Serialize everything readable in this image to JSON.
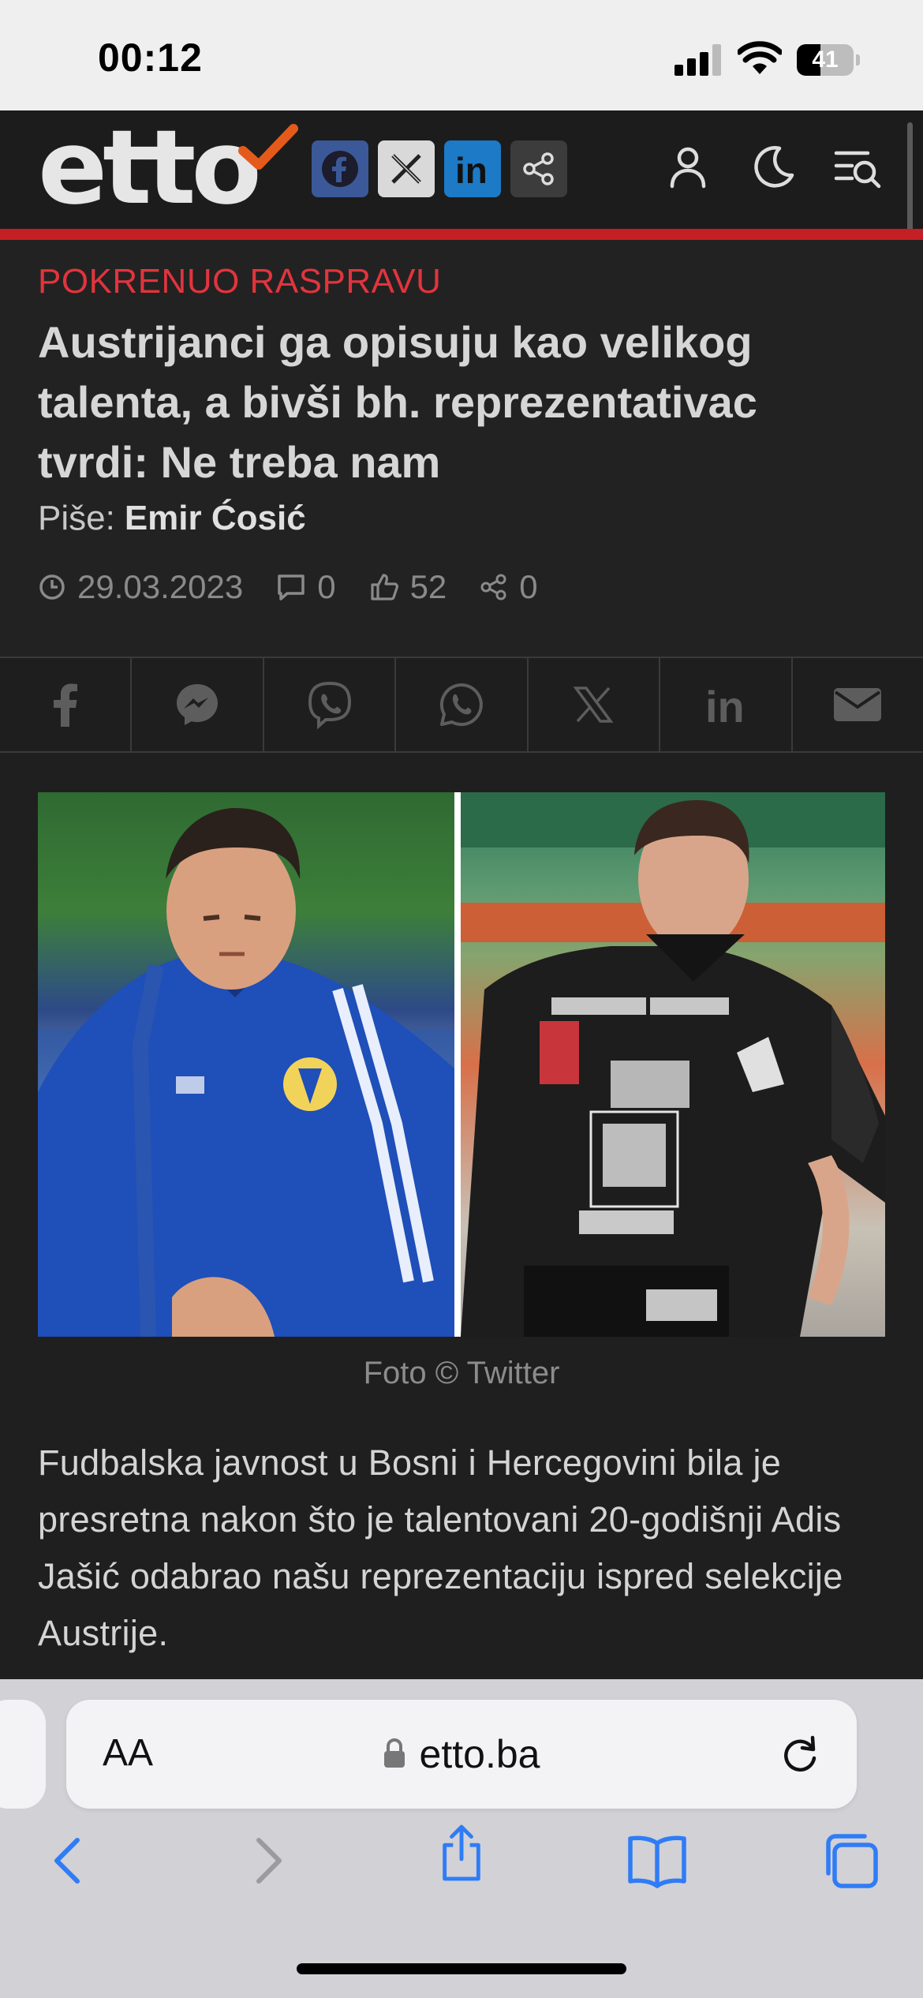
{
  "status_bar": {
    "time": "00:12",
    "battery": "41",
    "battery_level": 0.41
  },
  "site": {
    "logo": "etto",
    "social": [
      "facebook-icon",
      "x-icon",
      "linkedin-icon",
      "share-icon"
    ],
    "header_icons": [
      "user-icon",
      "moon-icon",
      "menu-search-icon"
    ]
  },
  "article": {
    "kicker": "POKRENUO RASPRAVU",
    "title": "Austrijanci ga opisuju kao velikog talenta, a bivši bh. reprezentativac tvrdi: Ne treba nam",
    "byline_label": "Piše:",
    "author": "Emir Ćosić",
    "date": "29.03.2023",
    "comments": "0",
    "likes": "52",
    "shares": "0",
    "share_buttons": [
      "facebook",
      "messenger",
      "viber",
      "whatsapp",
      "x",
      "linkedin",
      "email"
    ],
    "photo_caption": "Foto © Twitter",
    "body": "Fudbalska javnost u Bosni i Hercegovini bila je presretna nakon što je talentovani 20-godišnji Adis Jašić odabrao našu reprezentaciju ispred selekcije Austrije."
  },
  "browser": {
    "aa": "AA",
    "url": "etto.ba",
    "toolbar": [
      "back-icon",
      "forward-icon",
      "share-icon",
      "bookmarks-icon",
      "tabs-icon"
    ]
  },
  "colors": {
    "accent_red": "#c41f24",
    "kicker_red": "#e2343d",
    "ios_blue": "#2f7cf6"
  }
}
